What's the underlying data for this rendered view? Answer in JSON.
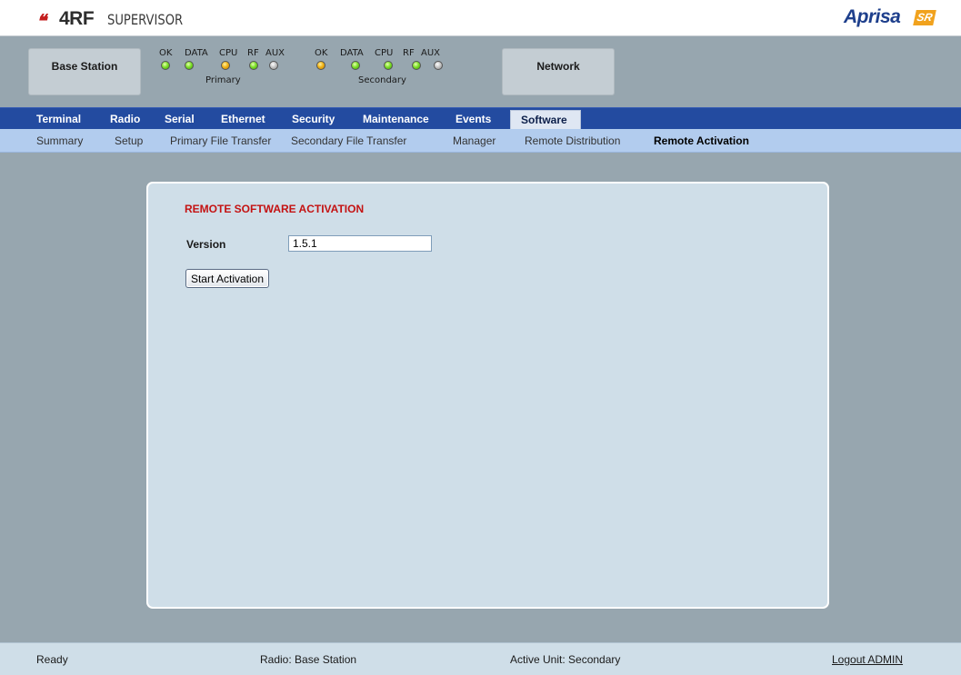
{
  "header": {
    "brand_mark": "❝",
    "brand": "4RF",
    "product": "SUPERVISOR",
    "right_logo": "Aprisa",
    "right_logo_badge": "SR"
  },
  "status": {
    "base_station_label": "Base Station",
    "network_label": "Network",
    "primary": {
      "name": "Primary",
      "leds": [
        {
          "label": "OK",
          "state": "green"
        },
        {
          "label": "DATA",
          "state": "green"
        },
        {
          "label": "CPU",
          "state": "orange"
        },
        {
          "label": "RF",
          "state": "green"
        },
        {
          "label": "AUX",
          "state": "grey"
        }
      ]
    },
    "secondary": {
      "name": "Secondary",
      "leds": [
        {
          "label": "OK",
          "state": "orange"
        },
        {
          "label": "DATA",
          "state": "green"
        },
        {
          "label": "CPU",
          "state": "green"
        },
        {
          "label": "RF",
          "state": "green"
        },
        {
          "label": "AUX",
          "state": "grey"
        }
      ]
    },
    "led_colors": {
      "green": "#7fe02a",
      "orange": "#f0b419",
      "grey": "#c8c8c8"
    }
  },
  "main_nav": {
    "tabs": [
      "Terminal",
      "Radio",
      "Serial",
      "Ethernet",
      "Security",
      "Maintenance",
      "Events",
      "Software"
    ],
    "active": "Software"
  },
  "sub_nav": {
    "items": [
      "Summary",
      "Setup",
      "Primary File Transfer",
      "Secondary File Transfer",
      "Manager",
      "Remote Distribution",
      "Remote Activation"
    ],
    "active": "Remote Activation"
  },
  "panel": {
    "title": "REMOTE SOFTWARE ACTIVATION",
    "version_label": "Version",
    "version_value": "1.5.1",
    "start_button": "Start Activation"
  },
  "footer": {
    "status": "Ready",
    "radio": "Radio: Base Station",
    "active_unit": "Active Unit: Secondary",
    "logout": "Logout ADMIN"
  },
  "colors": {
    "nav_bg": "#234ba0",
    "subnav_bg": "#b2ccee",
    "panel_bg": "#cfdee8",
    "page_bg": "#97a6af",
    "title_red": "#c41212"
  }
}
